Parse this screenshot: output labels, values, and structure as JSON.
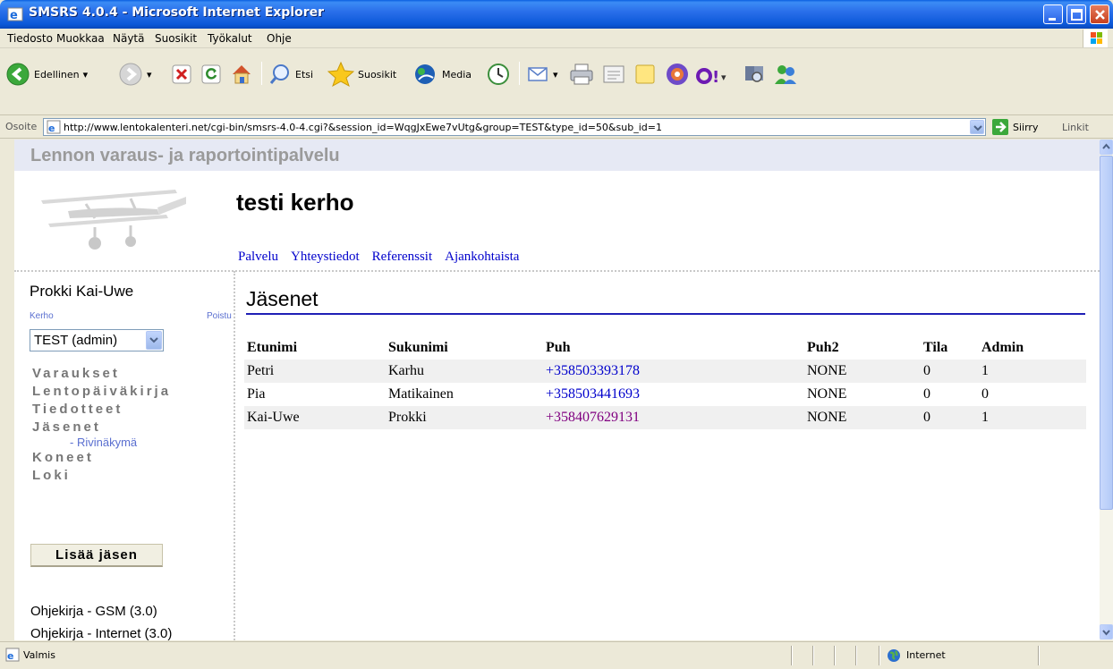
{
  "window": {
    "title": "SMSRS 4.0.4 - Microsoft Internet Explorer"
  },
  "menu": [
    "Tiedosto",
    "Muokkaa",
    "Näytä",
    "Suosikit",
    "Työkalut",
    "Ohje"
  ],
  "toolbar": {
    "back": "Edellinen",
    "search": "Etsi",
    "favorites": "Suosikit",
    "media": "Media"
  },
  "address": {
    "label": "Osoite",
    "url": "http://www.lentokalenteri.net/cgi-bin/smsrs-4.0-4.cgi?&session_id=WqgJxEwe7vUtg&group=TEST&type_id=50&sub_id=1",
    "go": "Siirry",
    "links": "Linkit"
  },
  "site": {
    "banner": "Lennon varaus- ja raportointipalvelu",
    "club": "testi kerho",
    "nav": [
      "Palvelu",
      "Yhteystiedot",
      "Referenssit",
      "Ajankohtaista"
    ]
  },
  "sidebar": {
    "user": "Prokki Kai-Uwe",
    "kerho_label": "Kerho",
    "logout": "Poistu",
    "club_select": "TEST (admin)",
    "items": [
      "Varaukset",
      "Lentopäiväkirja",
      "Tiedotteet",
      "Jäsenet"
    ],
    "subitem": "- Rivinäkymä",
    "items2": [
      "Koneet",
      "Loki"
    ],
    "add_button": "Lisää jäsen",
    "manuals": [
      "Ohjekirja - GSM (3.0)",
      "Ohjekirja - Internet (3.0)"
    ]
  },
  "main": {
    "title": "Jäsenet",
    "columns": [
      "Etunimi",
      "Sukunimi",
      "Puh",
      "Puh2",
      "Tila",
      "Admin"
    ],
    "rows": [
      [
        "Petri",
        "Karhu",
        "+358503393178",
        "NONE",
        "0",
        "1"
      ],
      [
        "Pia",
        "Matikainen",
        "+358503441693",
        "NONE",
        "0",
        "0"
      ],
      [
        "Kai-Uwe",
        "Prokki",
        "+358407629131",
        "NONE",
        "0",
        "1"
      ]
    ]
  },
  "status": {
    "text": "Valmis",
    "zone": "Internet"
  },
  "colors": {
    "link": "#0000CC",
    "visited": "#800080",
    "rule": "#1F1FB5",
    "sidebar_link": "#5A6FD0"
  }
}
